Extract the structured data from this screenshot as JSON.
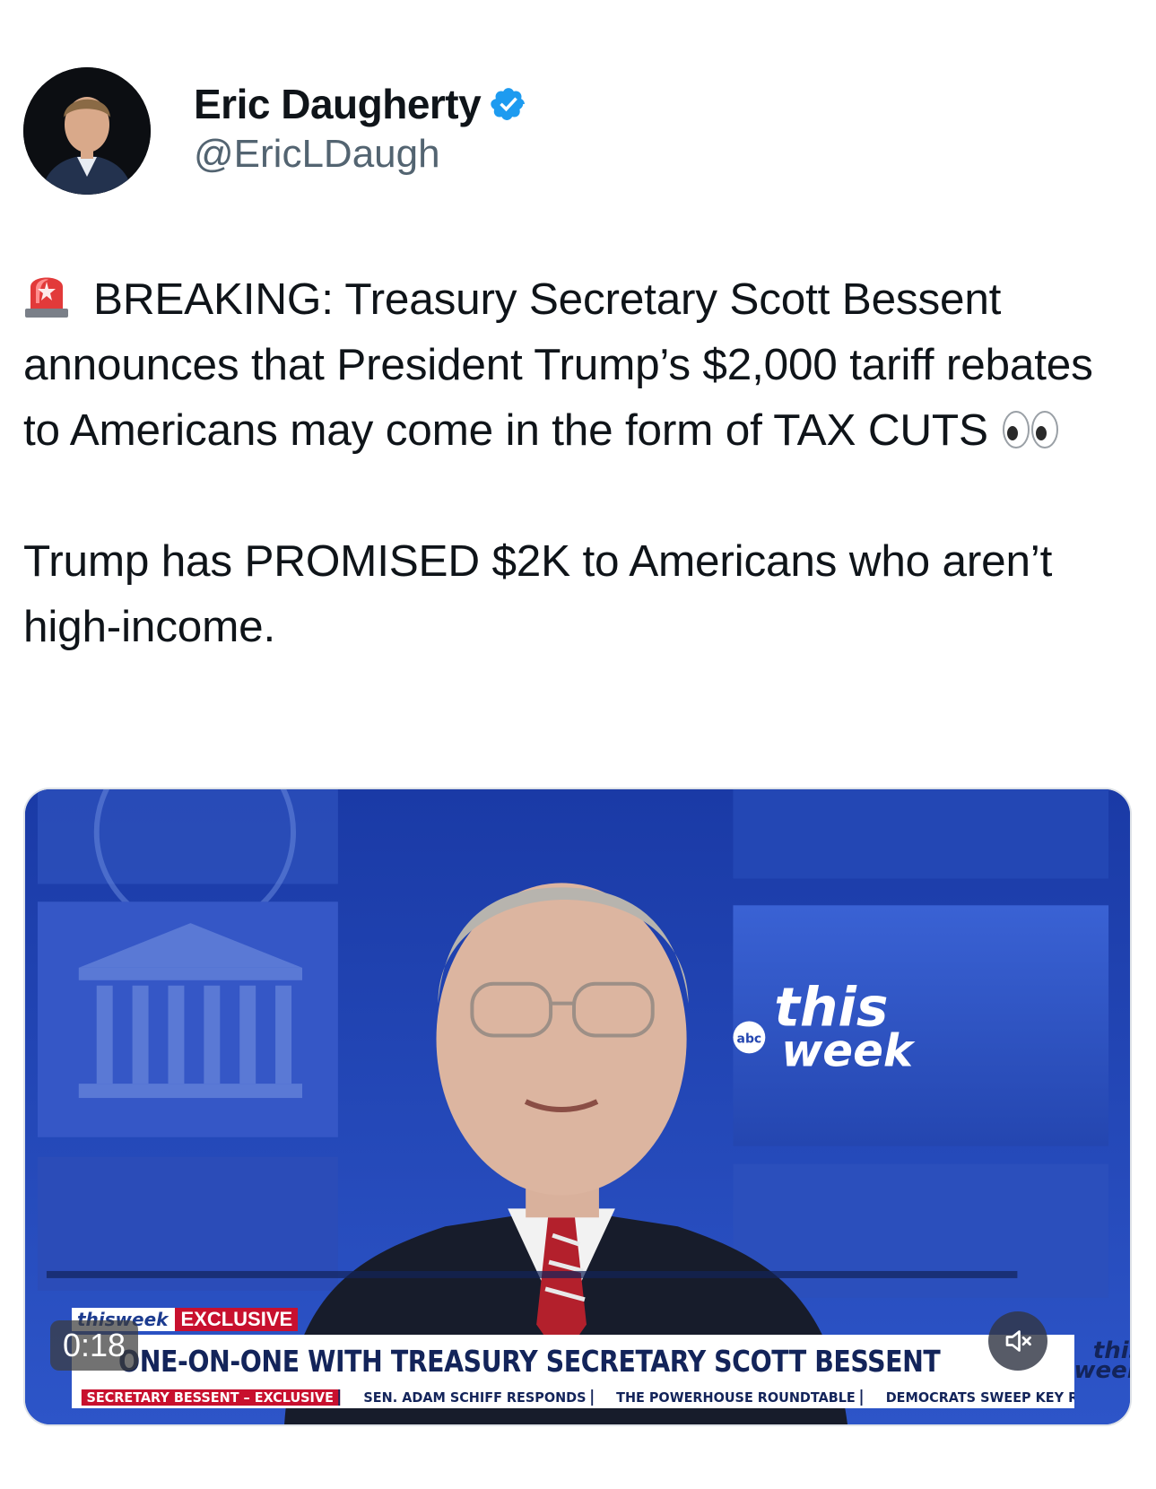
{
  "author": {
    "display_name": "Eric Daugherty",
    "handle": "@EricLDaugh",
    "verified": true,
    "avatar_icon": "profile-photo"
  },
  "tweet": {
    "paragraph_1": "BREAKING: Treasury Secretary Scott Bessent announces that President Trump’s $2,000 tariff rebates to Americans may come in the form of TAX CUTS",
    "paragraph_2": "Trump has PROMISED $2K to Americans who aren’t high-income.",
    "leading_emoji": "police-light-emoji",
    "trailing_emoji": "eyes-emoji"
  },
  "video": {
    "timestamp": "0:18",
    "muted": true,
    "studio_logo_top": "this",
    "studio_logo_bottom": "week",
    "studio_logo_badge": "abc",
    "lower_third": {
      "show_logo": "thisweek",
      "tag": "EXCLUSIVE",
      "headline": "ONE-ON-ONE WITH TREASURY SECRETARY SCOTT BESSENT",
      "ticker": [
        "SECRETARY BESSENT – EXCLUSIVE",
        "SEN. ADAM SCHIFF RESPONDS",
        "THE POWERHOUSE ROUNDTABLE",
        "DEMOCRATS SWEEP KEY RACES"
      ]
    }
  },
  "colors": {
    "text": "#0f1419",
    "secondary_text": "#536471",
    "verified_blue": "#1d9bf0",
    "abc_red": "#c8102e",
    "abc_navy": "#13245a"
  }
}
